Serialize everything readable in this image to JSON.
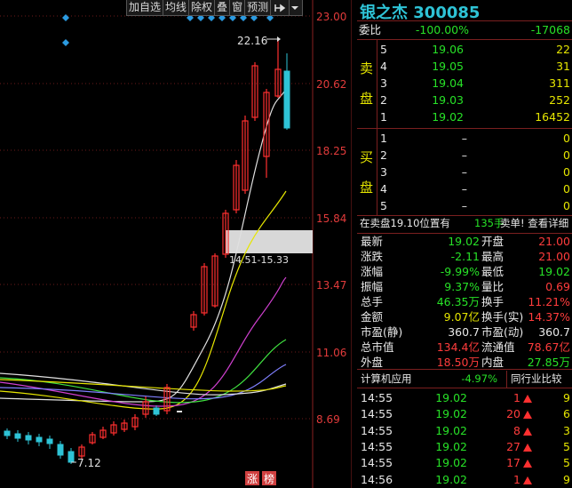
{
  "toolbar": {
    "buttons": [
      "加自选",
      "均线",
      "除权",
      "叠",
      "窗",
      "预测"
    ],
    "pin_icon": "pin-icon",
    "menu_icon": "chevron-down-icon"
  },
  "stock": {
    "name_code": "银之杰 300085"
  },
  "chart_axis": {
    "prices": [
      "23.00",
      "20.62",
      "18.25",
      "15.84",
      "13.47",
      "11.06",
      "8.69"
    ]
  },
  "chart_annotations": {
    "high": "22.16",
    "low": "7.12",
    "range": "14.51-15.33",
    "tag1": "涨",
    "tag2": "榜"
  },
  "weibi": {
    "label": "委比",
    "pct": "-100.00%",
    "diff": "-17068"
  },
  "sell": {
    "label": [
      "卖",
      "盘"
    ],
    "rows": [
      {
        "lvl": "5",
        "price": "19.06",
        "vol": "22"
      },
      {
        "lvl": "4",
        "price": "19.05",
        "vol": "31"
      },
      {
        "lvl": "3",
        "price": "19.04",
        "vol": "311"
      },
      {
        "lvl": "2",
        "price": "19.03",
        "vol": "252"
      },
      {
        "lvl": "1",
        "price": "19.02",
        "vol": "16452"
      }
    ]
  },
  "buy": {
    "label": [
      "买",
      "盘"
    ],
    "rows": [
      {
        "lvl": "1",
        "price": "–",
        "vol": "0"
      },
      {
        "lvl": "2",
        "price": "–",
        "vol": "0"
      },
      {
        "lvl": "3",
        "price": "–",
        "vol": "0"
      },
      {
        "lvl": "4",
        "price": "–",
        "vol": "0"
      },
      {
        "lvl": "5",
        "price": "–",
        "vol": "0"
      }
    ]
  },
  "sell_note": {
    "text": "在卖盘19.10位置有",
    "vol": "135手",
    "action": "卖单! 查看详细"
  },
  "quote": [
    {
      "l1": "最新",
      "v1": "19.02",
      "l2": "开盘",
      "v2": "21.00"
    },
    {
      "l1": "涨跌",
      "v1": "-2.11",
      "l2": "最高",
      "v2": "21.00"
    },
    {
      "l1": "涨幅",
      "v1": "-9.99%",
      "l2": "最低",
      "v2": "19.02"
    },
    {
      "l1": "振幅",
      "v1": "9.37%",
      "l2": "量比",
      "v2": "0.69"
    },
    {
      "l1": "总手",
      "v1": "46.35万",
      "l2": "换手",
      "v2": "11.21%"
    },
    {
      "l1": "金额",
      "v1": "9.07亿",
      "l2": "换手(实)",
      "v2": "14.37%"
    },
    {
      "l1": "市盈(静)",
      "v1": "360.7",
      "l2": "市盈(动)",
      "v2": "360.7"
    },
    {
      "l1": "总市值",
      "v1": "134.4亿",
      "l2": "流通值",
      "v2": "78.67亿"
    },
    {
      "l1": "外盘",
      "v1": "18.50万",
      "l2": "内盘",
      "v2": "27.85万"
    }
  ],
  "industry": {
    "name": "计算机应用",
    "pct": "-4.97%",
    "compare": "同行业比较"
  },
  "ticks": [
    {
      "time": "14:55",
      "price": "19.02",
      "vol": "1",
      "n": "9"
    },
    {
      "time": "14:55",
      "price": "19.02",
      "vol": "20",
      "n": "6"
    },
    {
      "time": "14:55",
      "price": "19.02",
      "vol": "8",
      "n": "3"
    },
    {
      "time": "14:55",
      "price": "19.02",
      "vol": "27",
      "n": "5"
    },
    {
      "time": "14:55",
      "price": "19.02",
      "vol": "17",
      "n": "5"
    },
    {
      "time": "14:56",
      "price": "19.02",
      "vol": "1",
      "n": "9"
    }
  ]
}
